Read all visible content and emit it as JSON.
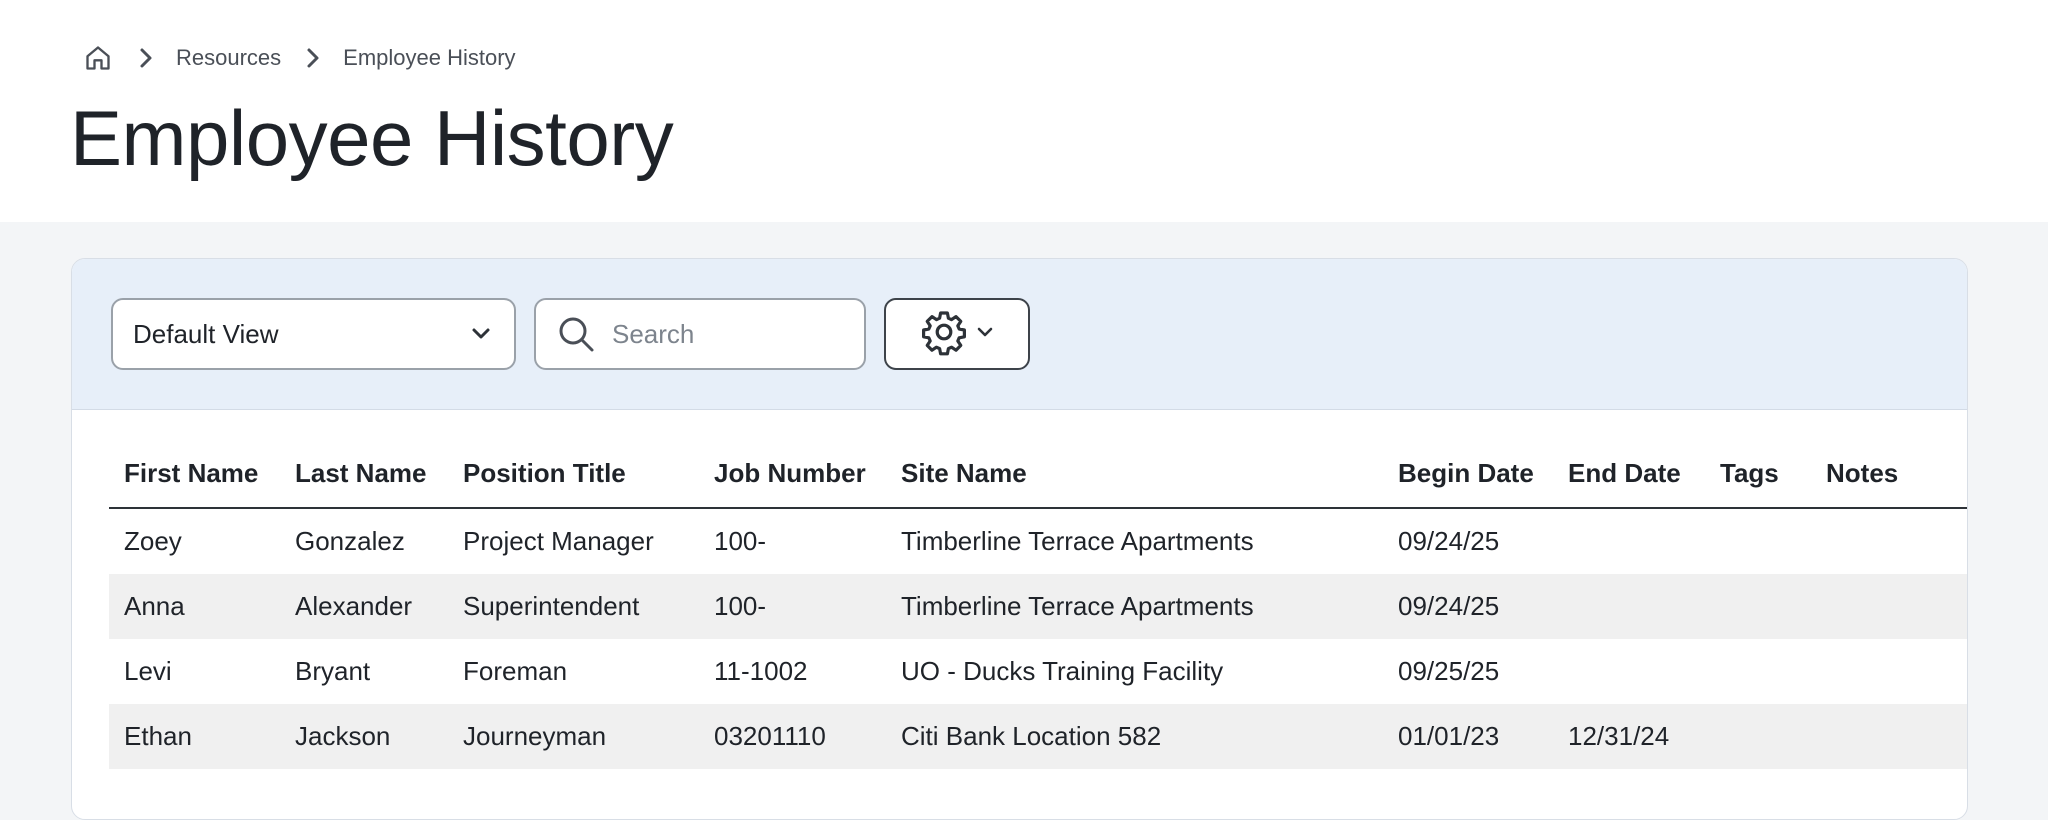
{
  "breadcrumb": {
    "home_icon": "home-icon",
    "separator_icon": "chevron-right-icon",
    "items": [
      "Resources",
      "Employee History"
    ]
  },
  "page": {
    "title": "Employee History"
  },
  "toolbar": {
    "view_select": {
      "selected": "Default View",
      "icon": "chevron-down-icon"
    },
    "search": {
      "placeholder": "Search",
      "value": "",
      "icon": "search-icon"
    },
    "settings": {
      "icon": "gear-icon",
      "dropdown_icon": "chevron-down-icon"
    }
  },
  "table": {
    "columns": [
      "First Name",
      "Last Name",
      "Position Title",
      "Job Number",
      "Site Name",
      "Begin Date",
      "End Date",
      "Tags",
      "Notes"
    ],
    "rows": [
      [
        "Zoey",
        "Gonzalez",
        "Project Manager",
        "100-",
        "Timberline Terrace Apartments",
        "09/24/25",
        "",
        "",
        ""
      ],
      [
        "Anna",
        "Alexander",
        "Superintendent",
        "100-",
        "Timberline Terrace Apartments",
        "09/24/25",
        "",
        "",
        ""
      ],
      [
        "Levi",
        "Bryant",
        "Foreman",
        "11-1002",
        "UO - Ducks Training Facility",
        "09/25/25",
        "",
        "",
        ""
      ],
      [
        "Ethan",
        "Jackson",
        "Journeyman",
        "03201110",
        "Citi Bank Location 582",
        "01/01/23",
        "12/31/24",
        "",
        ""
      ]
    ]
  },
  "colors": {
    "toolbar_bg": "#e7eff9",
    "page_bg": "#f3f5f7",
    "stripe": "#f0f0f0",
    "text": "#1f2329"
  }
}
